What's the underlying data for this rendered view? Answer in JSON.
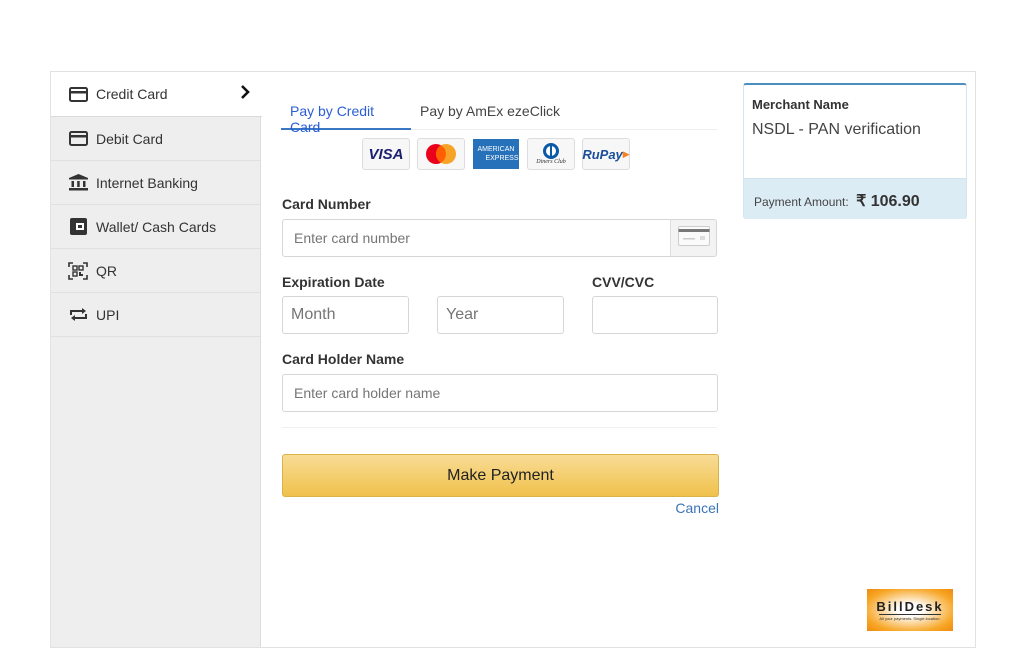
{
  "sidebar": {
    "items": [
      {
        "label": "Credit Card",
        "icon": "credit-card-icon",
        "active": true
      },
      {
        "label": "Debit Card",
        "icon": "debit-card-icon"
      },
      {
        "label": "Internet Banking",
        "icon": "bank-icon"
      },
      {
        "label": "Wallet/ Cash Cards",
        "icon": "wallet-icon"
      },
      {
        "label": "QR",
        "icon": "qr-code-icon"
      },
      {
        "label": "UPI",
        "icon": "upi-icon"
      }
    ],
    "active_indicator": "›"
  },
  "tabs": [
    {
      "label": "Pay by Credit Card",
      "active": true
    },
    {
      "label": "Pay by AmEx ezeClick",
      "active": false
    }
  ],
  "card_logos": [
    "VISA",
    "Mastercard",
    "American Express",
    "Diners Club",
    "RuPay"
  ],
  "card_logo_text": {
    "visa": "VISA",
    "amex_1": "AMERICAN",
    "amex_2": "EXPRESS",
    "diners": "Diners Club",
    "rupay": "RuPay"
  },
  "form": {
    "card_number_label": "Card Number",
    "card_number_placeholder": "Enter card number",
    "expiration_label": "Expiration Date",
    "month_placeholder": "Month",
    "year_placeholder": "Year",
    "cvv_label": "CVV/CVC",
    "cvv_value": "",
    "holder_label": "Card Holder Name",
    "holder_placeholder": "Enter card holder name",
    "submit_label": "Make Payment",
    "cancel_label": "Cancel"
  },
  "merchant": {
    "title": "Merchant Name",
    "name": "NSDL - PAN verification",
    "amount_label": "Payment Amount:",
    "amount": "₹ 106.90"
  },
  "brand": {
    "name": "BillDesk",
    "tagline": "All your payments. Single location."
  },
  "colors": {
    "accent_blue": "#2a5dd6",
    "button_gold": "#f0c14b",
    "amount_bg": "#dcecf5"
  }
}
